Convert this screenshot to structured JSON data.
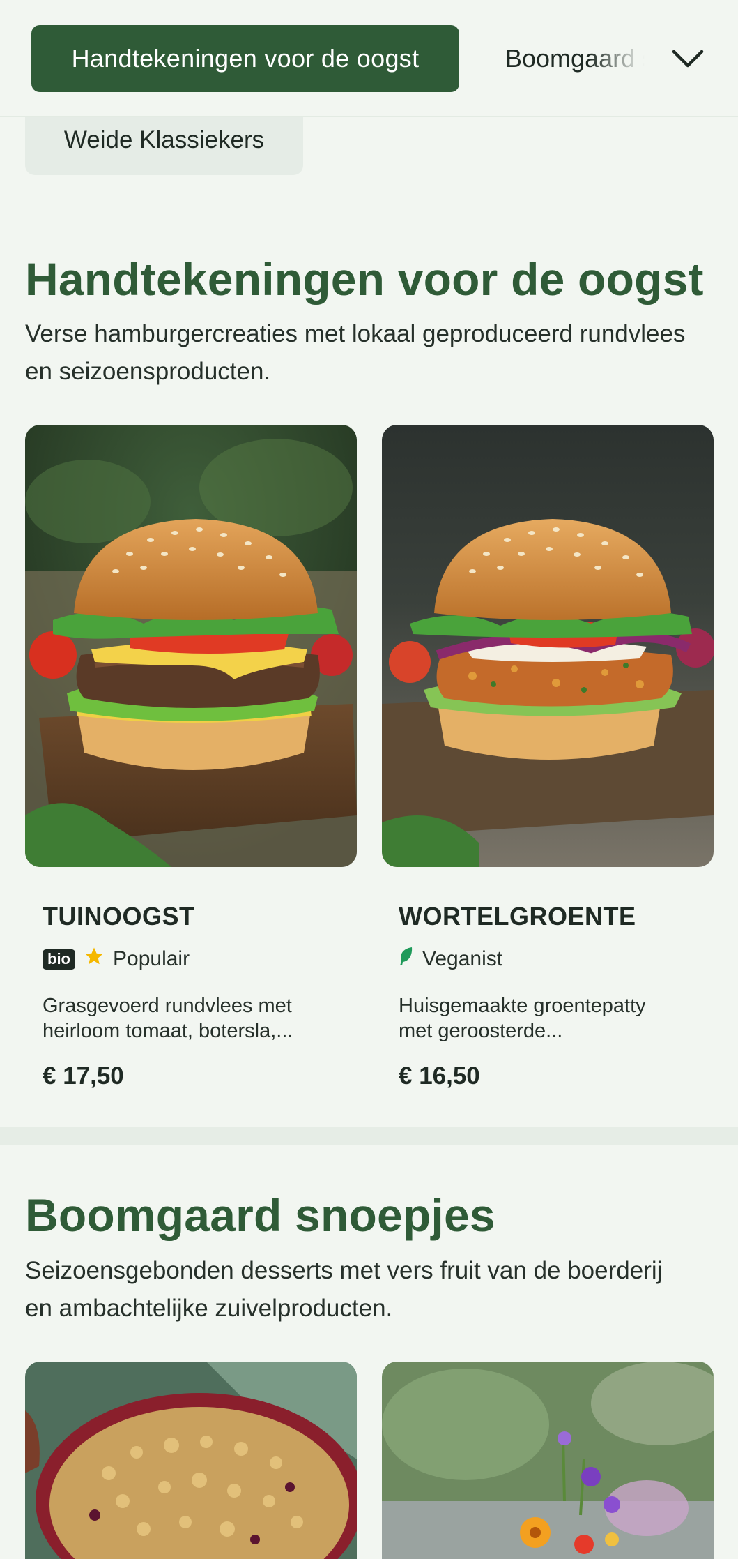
{
  "nav": {
    "active_tab": "Handtekeningen voor de oogst",
    "next_tab": "Boomgaard snoepjes",
    "under_tab": "Weide Klassiekers",
    "chevron_icon": "chevron-down-icon"
  },
  "sections": [
    {
      "title": "Handtekeningen voor de oogst",
      "description": "Verse hamburgercreaties met lokaal geproduceerd rundvlees en seizoensproducten.",
      "items": [
        {
          "name": "TUINOOGST",
          "badge": "bio",
          "tag_icon": "star-icon",
          "tag": "Populair",
          "description_line1": "Grasgevoerd rundvlees met",
          "description_line2": "heirloom tomaat, botersla,...",
          "price": "€ 17,50"
        },
        {
          "name": "WORTELGROENTE",
          "tag_icon": "leaf-icon",
          "tag": "Veganist",
          "description_line1": "Huisgemaakte groentepatty",
          "description_line2": "met geroosterde...",
          "price": "€ 16,50"
        }
      ]
    },
    {
      "title": "Boomgaard snoepjes",
      "description": "Seizoensgebonden desserts met vers fruit van de boerderij en ambachtelijke zuivelproducten."
    }
  ],
  "colors": {
    "brand_green": "#2f5b37",
    "background": "#f2f6f1",
    "star": "#f5b800",
    "leaf": "#1f9a5a"
  }
}
